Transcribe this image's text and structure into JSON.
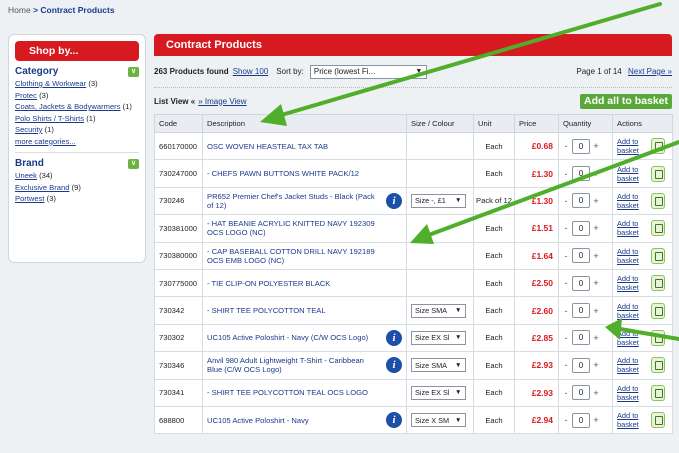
{
  "breadcrumb": {
    "home": "Home",
    "sep": ">",
    "current": "Contract Products"
  },
  "sidebar": {
    "shop_by": "Shop by...",
    "category": {
      "title": "Category",
      "items": [
        {
          "label": "Clothing & Workwear",
          "count": "(3)"
        },
        {
          "label": "Protec",
          "count": "(3)"
        },
        {
          "label": "Coats, Jackets & Bodywarmers",
          "count": "(1)"
        },
        {
          "label": "Polo Shirts / T-Shirts",
          "count": "(1)"
        },
        {
          "label": "Security",
          "count": "(1)"
        }
      ],
      "more": "more categories..."
    },
    "brand": {
      "title": "Brand",
      "items": [
        {
          "label": "Uneek",
          "count": "(34)"
        },
        {
          "label": "Exclusive Brand",
          "count": "(9)"
        },
        {
          "label": "Portwest",
          "count": "(3)"
        }
      ]
    }
  },
  "main": {
    "title": "Contract Products",
    "found": "263 Products found",
    "show100": "Show 100",
    "sort_label": "Sort by:",
    "sort_value": "Price (lowest Fi...",
    "page_text": "Page 1 of 14",
    "next_page": "Next Page »",
    "list_view": "List View «",
    "image_view": "» Image View",
    "add_all": "Add all to basket"
  },
  "table": {
    "headers": [
      "Code",
      "Description",
      "Size / Colour",
      "Unit",
      "Price",
      "Quantity",
      "Actions"
    ],
    "rows": [
      {
        "code": "660170000",
        "desc": "OSC WOVEN HEASTEAL TAX TAB",
        "info": false,
        "size": "",
        "unit": "Each",
        "price": "£0.68",
        "qty": "0",
        "action": "Add to basket"
      },
      {
        "code": "730247000",
        "desc": "- CHEFS PAWN BUTTONS WHITE PACK/12",
        "info": false,
        "size": "",
        "unit": "Each",
        "price": "£1.30",
        "qty": "0",
        "action": "Add to basket"
      },
      {
        "code": "730246",
        "desc": "PR652 Premier Chef's Jacket Studs - Black (Pack of 12)",
        "info": true,
        "size": "Size -, £1",
        "unit": "Pack of 12",
        "price": "£1.30",
        "qty": "0",
        "action": "Add to basket"
      },
      {
        "code": "730381000",
        "desc": "- HAT BEANIE ACRYLIC KNITTED NAVY 192309 OCS LOGO (NC)",
        "info": false,
        "size": "",
        "unit": "Each",
        "price": "£1.51",
        "qty": "0",
        "action": "Add to basket"
      },
      {
        "code": "730380000",
        "desc": "- CAP BASEBALL COTTON DRILL NAVY 192189 OCS EMB LOGO (NC)",
        "info": false,
        "size": "",
        "unit": "Each",
        "price": "£1.64",
        "qty": "0",
        "action": "Add to basket"
      },
      {
        "code": "730775000",
        "desc": "- TIE CLIP-ON POLYESTER BLACK",
        "info": false,
        "size": "",
        "unit": "Each",
        "price": "£2.50",
        "qty": "0",
        "action": "Add to basket"
      },
      {
        "code": "730342",
        "desc": "- SHIRT TEE POLYCOTTON TEAL",
        "info": false,
        "size": "Size SMA",
        "unit": "Each",
        "price": "£2.60",
        "qty": "0",
        "action": "Add to basket"
      },
      {
        "code": "730302",
        "desc": "UC105 Active Poloshirt - Navy (C/W OCS Logo)",
        "info": true,
        "size": "Size EX Sl",
        "unit": "Each",
        "price": "£2.85",
        "qty": "0",
        "action": "Add to basket"
      },
      {
        "code": "730346",
        "desc": "Anvil 980 Adult Lightweight T-Shirt - Caribbean Blue (C/W OCS Logo)",
        "info": true,
        "size": "Size SMA",
        "unit": "Each",
        "price": "£2.93",
        "qty": "0",
        "action": "Add to basket"
      },
      {
        "code": "730341",
        "desc": "- SHIRT TEE POLYCOTTON TEAL OCS LOGO",
        "info": false,
        "size": "Size EX Sl",
        "unit": "Each",
        "price": "£2.93",
        "qty": "0",
        "action": "Add to basket"
      },
      {
        "code": "688800",
        "desc": "UC105 Active Poloshirt - Navy",
        "info": true,
        "size": "Size X SM",
        "unit": "Each",
        "price": "£2.94",
        "qty": "0",
        "action": "Add to basket"
      }
    ]
  },
  "colors": {
    "brand_red": "#d71920",
    "green": "#5aa83a",
    "link_blue": "#1a3a8c",
    "arrow_green": "#4fae2a"
  }
}
